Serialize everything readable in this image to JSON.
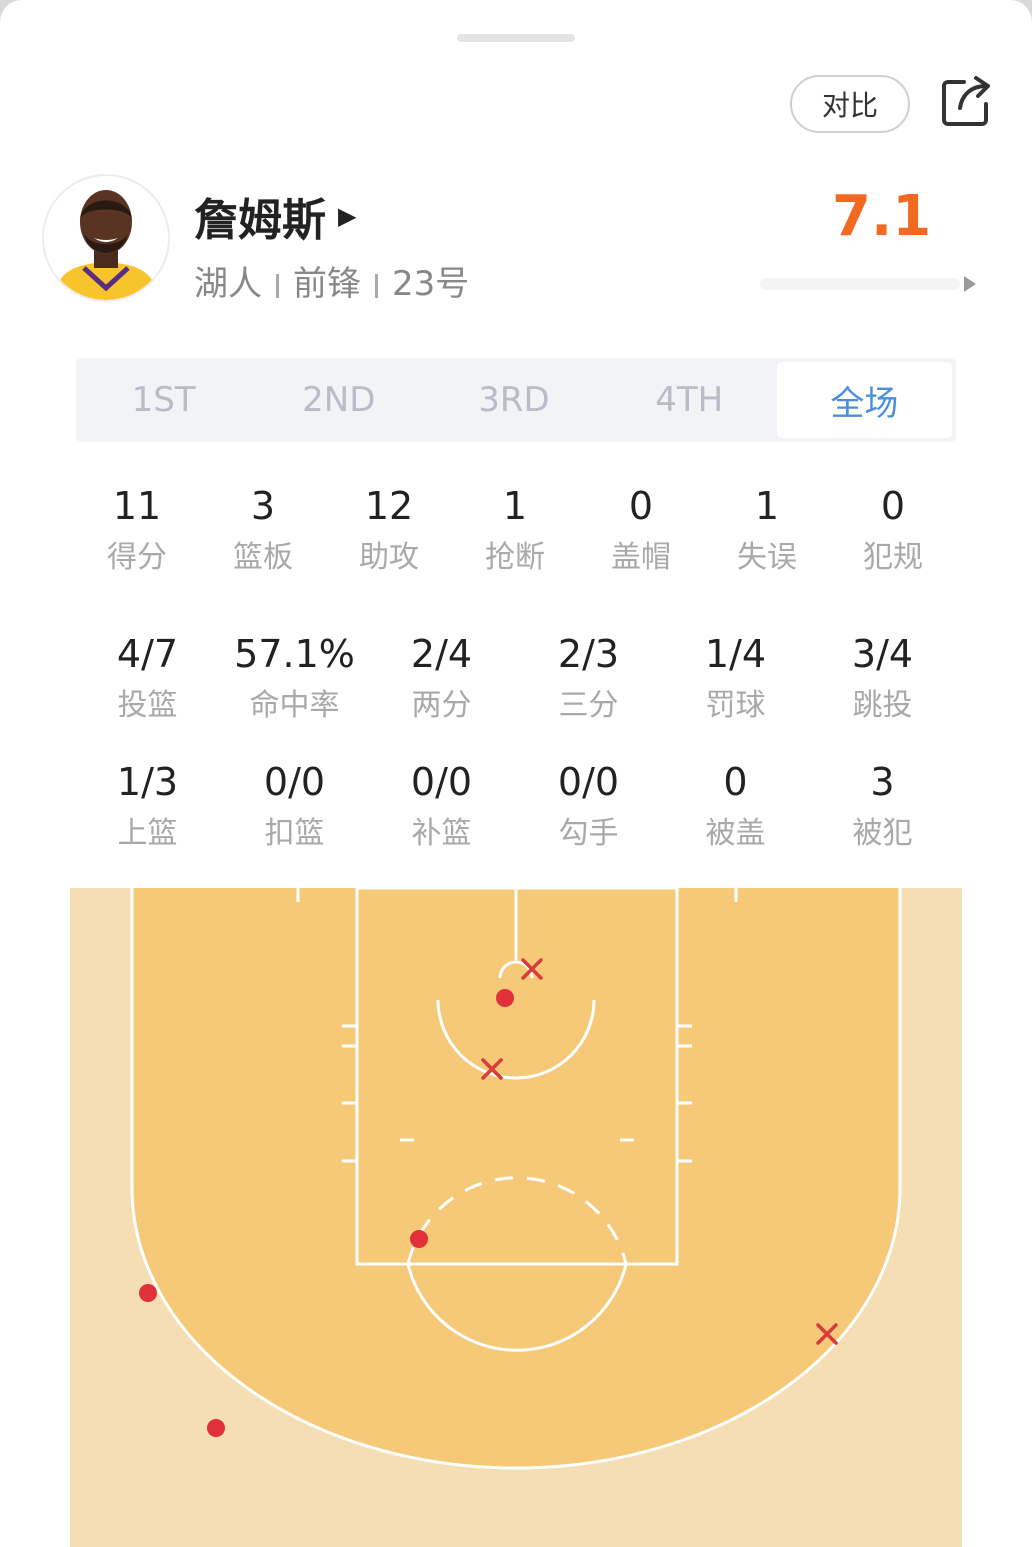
{
  "header": {
    "compare_label": "对比",
    "share_icon": "share-icon"
  },
  "player": {
    "name": "詹姆斯",
    "team": "湖人",
    "position": "前锋",
    "number": "23号",
    "rating": "7.1",
    "rating_color": "#f26a21"
  },
  "tabs": [
    {
      "label": "1ST",
      "active": false
    },
    {
      "label": "2ND",
      "active": false
    },
    {
      "label": "3RD",
      "active": false
    },
    {
      "label": "4TH",
      "active": false
    },
    {
      "label": "全场",
      "active": true
    }
  ],
  "stats_row1": [
    {
      "value": "11",
      "label": "得分"
    },
    {
      "value": "3",
      "label": "篮板"
    },
    {
      "value": "12",
      "label": "助攻"
    },
    {
      "value": "1",
      "label": "抢断"
    },
    {
      "value": "0",
      "label": "盖帽"
    },
    {
      "value": "1",
      "label": "失误"
    },
    {
      "value": "0",
      "label": "犯规"
    }
  ],
  "stats_row2": [
    {
      "value": "4/7",
      "label": "投篮"
    },
    {
      "value": "57.1%",
      "label": "命中率"
    },
    {
      "value": "2/4",
      "label": "两分"
    },
    {
      "value": "2/3",
      "label": "三分"
    },
    {
      "value": "1/4",
      "label": "罚球"
    },
    {
      "value": "3/4",
      "label": "跳投"
    }
  ],
  "stats_row3": [
    {
      "value": "1/3",
      "label": "上篮"
    },
    {
      "value": "0/0",
      "label": "扣篮"
    },
    {
      "value": "0/0",
      "label": "补篮"
    },
    {
      "value": "0/0",
      "label": "勾手"
    },
    {
      "value": "0",
      "label": "被盖"
    },
    {
      "value": "3",
      "label": "被犯"
    }
  ],
  "colors": {
    "court_outer": "#f6deb4",
    "court_inner": "#f5c977",
    "made_shot": "#e0303a",
    "missed_shot": "#d93a3a",
    "accent_tab": "#4a8fd9"
  }
}
